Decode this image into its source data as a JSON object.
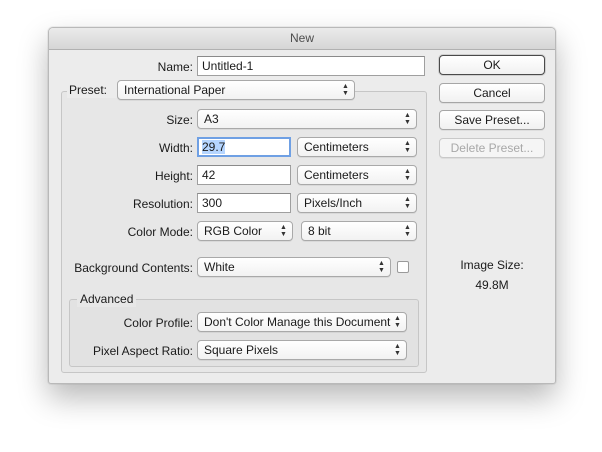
{
  "window": {
    "title": "New"
  },
  "name": {
    "label": "Name:",
    "value": "Untitled-1"
  },
  "preset": {
    "label": "Preset:",
    "value": "International Paper"
  },
  "size": {
    "label": "Size:",
    "value": "A3"
  },
  "width": {
    "label": "Width:",
    "value": "29.7",
    "unit": "Centimeters"
  },
  "height": {
    "label": "Height:",
    "value": "42",
    "unit": "Centimeters"
  },
  "resolution": {
    "label": "Resolution:",
    "value": "300",
    "unit": "Pixels/Inch"
  },
  "color_mode": {
    "label": "Color Mode:",
    "value": "RGB Color",
    "depth": "8 bit"
  },
  "background": {
    "label": "Background Contents:",
    "value": "White",
    "swatch_color": "#ffffff"
  },
  "advanced": {
    "title": "Advanced",
    "color_profile": {
      "label": "Color Profile:",
      "value": "Don't Color Manage this Document"
    },
    "pixel_aspect": {
      "label": "Pixel Aspect Ratio:",
      "value": "Square Pixels"
    }
  },
  "buttons": {
    "ok": "OK",
    "cancel": "Cancel",
    "save_preset": "Save Preset...",
    "delete_preset": "Delete Preset..."
  },
  "image_size": {
    "label": "Image Size:",
    "value": "49.8M"
  }
}
